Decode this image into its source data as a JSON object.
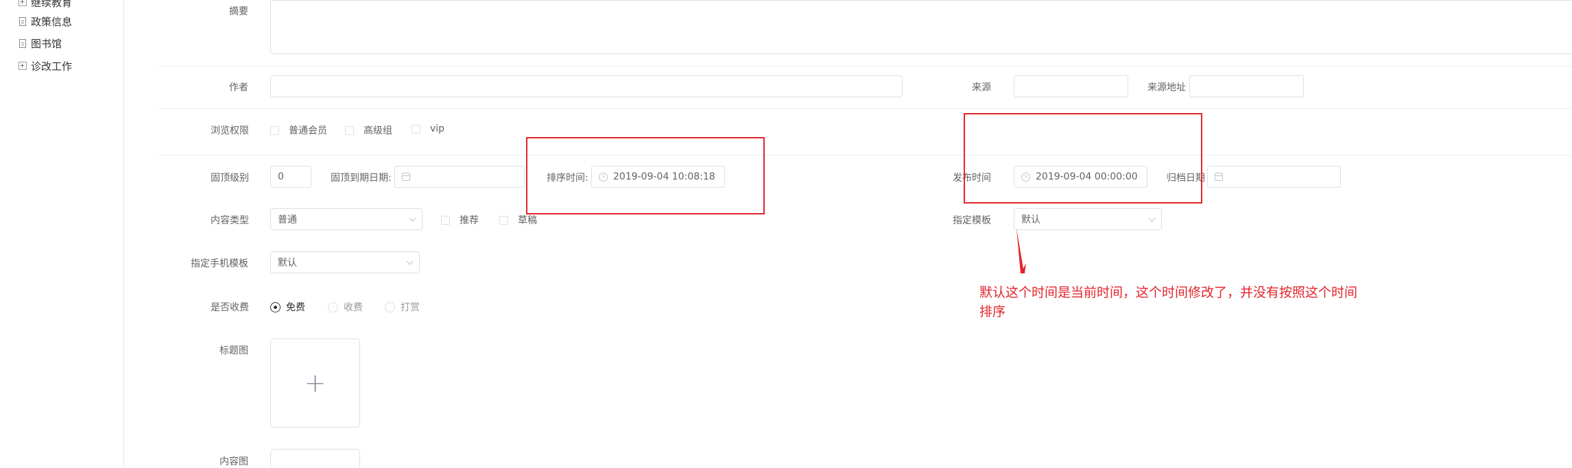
{
  "sidebar": {
    "items": [
      {
        "label": "继续教育",
        "icon": "plus-box-icon"
      },
      {
        "label": "政策信息",
        "icon": "document-icon"
      },
      {
        "label": "图书馆",
        "icon": "document-icon"
      },
      {
        "label": "诊改工作",
        "icon": "plus-box-icon"
      }
    ]
  },
  "form": {
    "summary_label": "摘要",
    "author_label": "作者",
    "author_value": "",
    "source_label": "来源",
    "source_value": "",
    "source_url_label": "来源地址",
    "source_url_value": "",
    "permission_label": "浏览权限",
    "permissions": [
      "普通会员",
      "高级组",
      "vip"
    ],
    "pin_level_label": "固顶级别",
    "pin_level_value": "0",
    "pin_expire_label": "固顶到期日期:",
    "sort_time_label": "排序时间:",
    "sort_time_value": "2019-09-04 10:08:18",
    "publish_time_label": "发布时间",
    "publish_time_value": "2019-09-04 00:00:00",
    "archive_date_label": "归档日期",
    "content_type_label": "内容类型",
    "content_type_value": "普通",
    "recommend_label": "推荐",
    "draft_label": "草稿",
    "template_label": "指定模板",
    "template_value": "默认",
    "mobile_template_label": "指定手机模板",
    "mobile_template_value": "默认",
    "charge_label": "是否收费",
    "charge_options": [
      "免费",
      "收费",
      "打赏"
    ],
    "charge_selected": "免费",
    "title_image_label": "标题图",
    "content_image_label": "内容图"
  },
  "annotation": {
    "line1": "默认这个时间是当前时间，这个时间修改了，并没有按照这个时间",
    "line2": "排序",
    "color": "#e3242b"
  }
}
